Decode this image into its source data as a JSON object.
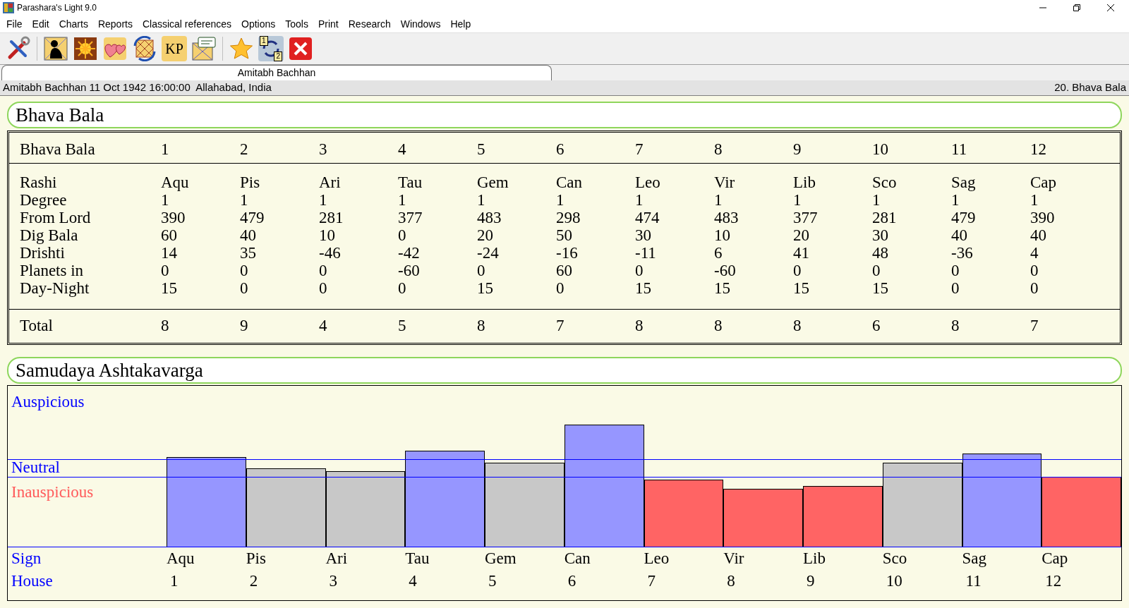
{
  "window": {
    "title": "Parashara's Light 9.0"
  },
  "menu": [
    "File",
    "Edit",
    "Charts",
    "Reports",
    "Classical references",
    "Options",
    "Tools",
    "Print",
    "Research",
    "Windows",
    "Help"
  ],
  "toolbar": [
    {
      "kind": "tools"
    },
    {
      "kind": "child",
      "separator_before": true
    },
    {
      "kind": "sun"
    },
    {
      "kind": "hearts"
    },
    {
      "kind": "rotate"
    },
    {
      "kind": "kp",
      "label": "KP"
    },
    {
      "kind": "chat"
    },
    {
      "kind": "star",
      "separator_before": true
    },
    {
      "kind": "swap",
      "label": "1",
      "label2": "2"
    },
    {
      "kind": "close"
    }
  ],
  "tabs": [
    {
      "label": "Amitabh Bachhan",
      "selected": true
    }
  ],
  "info_bar": {
    "left": "Amitabh Bachhan 11 Oct 1942 16:00:00  Allahabad, India",
    "right": "20. Bhava Bala"
  },
  "bhava_bala": {
    "title": "Bhava Bala",
    "columns": [
      "Bhava Bala",
      "1",
      "2",
      "3",
      "4",
      "5",
      "6",
      "7",
      "8",
      "9",
      "10",
      "11",
      "12"
    ],
    "rows": [
      {
        "label": "Rashi",
        "values": [
          "Aqu",
          "Pis",
          "Ari",
          "Tau",
          "Gem",
          "Can",
          "Leo",
          "Vir",
          "Lib",
          "Sco",
          "Sag",
          "Cap"
        ]
      },
      {
        "label": "Degree",
        "values": [
          "1",
          "1",
          "1",
          "1",
          "1",
          "1",
          "1",
          "1",
          "1",
          "1",
          "1",
          "1"
        ]
      },
      {
        "label": "From Lord",
        "values": [
          "390",
          "479",
          "281",
          "377",
          "483",
          "298",
          "474",
          "483",
          "377",
          "281",
          "479",
          "390"
        ]
      },
      {
        "label": "Dig Bala",
        "values": [
          "60",
          "40",
          "10",
          "0",
          "20",
          "50",
          "30",
          "10",
          "20",
          "30",
          "40",
          "40"
        ]
      },
      {
        "label": "Drishti",
        "values": [
          "14",
          "35",
          "-46",
          "-42",
          "-24",
          "-16",
          "-11",
          "6",
          "41",
          "48",
          "-36",
          "4"
        ]
      },
      {
        "label": "Planets in",
        "values": [
          "0",
          "0",
          "0",
          "-60",
          "0",
          "60",
          "0",
          "-60",
          "0",
          "0",
          "0",
          "0"
        ]
      },
      {
        "label": "Day-Night",
        "values": [
          "15",
          "0",
          "0",
          "0",
          "15",
          "0",
          "15",
          "15",
          "15",
          "15",
          "0",
          "0"
        ]
      }
    ],
    "total": {
      "label": "Total",
      "values": [
        "8",
        "9",
        "4",
        "5",
        "8",
        "7",
        "8",
        "8",
        "8",
        "6",
        "8",
        "7"
      ]
    }
  },
  "samudaya": {
    "title": "Samudaya Ashtakavarga",
    "bands": {
      "auspicious": "Auspicious",
      "neutral": "Neutral",
      "inauspicious": "Inauspicious"
    },
    "row_labels": {
      "sign": "Sign",
      "house": "House"
    },
    "columns": [
      {
        "sign": "Aqu",
        "house": "1",
        "kind": "auspicious"
      },
      {
        "sign": "Pis",
        "house": "2",
        "kind": "neutral"
      },
      {
        "sign": "Ari",
        "house": "3",
        "kind": "neutral"
      },
      {
        "sign": "Tau",
        "house": "4",
        "kind": "auspicious"
      },
      {
        "sign": "Gem",
        "house": "5",
        "kind": "neutral"
      },
      {
        "sign": "Can",
        "house": "6",
        "kind": "auspicious"
      },
      {
        "sign": "Leo",
        "house": "7",
        "kind": "inauspicious"
      },
      {
        "sign": "Vir",
        "house": "8",
        "kind": "inauspicious"
      },
      {
        "sign": "Lib",
        "house": "9",
        "kind": "inauspicious"
      },
      {
        "sign": "Sco",
        "house": "10",
        "kind": "neutral"
      },
      {
        "sign": "Sag",
        "house": "11",
        "kind": "auspicious"
      },
      {
        "sign": "Cap",
        "house": "12",
        "kind": "inauspicious"
      }
    ]
  }
}
